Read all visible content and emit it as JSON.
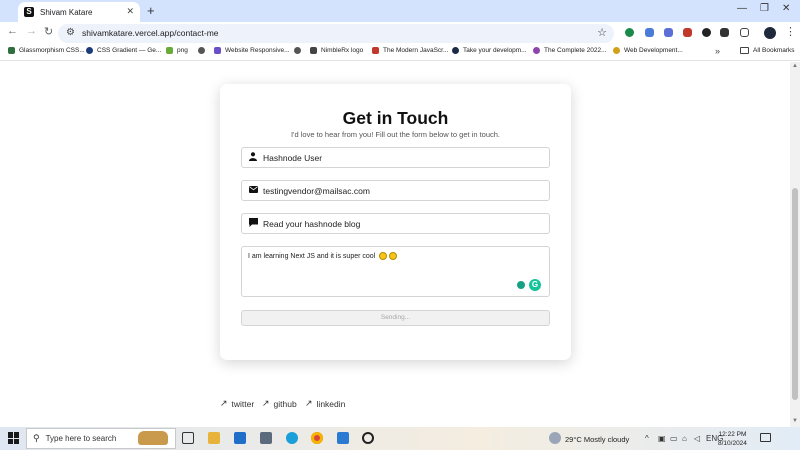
{
  "browser": {
    "tab_title": "Shivam Katare",
    "favicon_letter": "S",
    "url": "shivamkatare.vercel.app/contact-me"
  },
  "bookmarks": [
    {
      "label": "Glassmorphism CSS...",
      "color": "#2f6f3e"
    },
    {
      "label": "CSS Gradient — Ge...",
      "color": "#1d3b78"
    },
    {
      "label": "png",
      "color": "#6aaa3a"
    },
    {
      "label": "",
      "color": "#555555"
    },
    {
      "label": "Website Responsive...",
      "color": "#6a4fc9"
    },
    {
      "label": "",
      "color": "#555555"
    },
    {
      "label": "NimbleRx logo",
      "color": "#444444"
    },
    {
      "label": "The Modern JavaScr...",
      "color": "#c0392b"
    },
    {
      "label": "Take your developm...",
      "color": "#1c2a48"
    },
    {
      "label": "The Complete 2022...",
      "color": "#8e44ad"
    },
    {
      "label": "Web Development...",
      "color": "#d4a017"
    }
  ],
  "all_bookmarks_label": "All Bookmarks",
  "contact": {
    "title": "Get in Touch",
    "subtitle": "I'd love to hear from you! Fill out the form below to get in touch.",
    "name_value": "Hashnode User",
    "email_value": "testingvendor@mailsac.com",
    "subject_value": "Read your hashnode blog",
    "message_value": "I am learning Next JS and it is super cool",
    "submit_label": "Sending..."
  },
  "social_links": [
    "twitter",
    "github",
    "linkedin"
  ],
  "taskbar": {
    "search_placeholder": "Type here to search",
    "weather": "29°C  Mostly cloudy",
    "time": "12:22 PM",
    "date": "8/10/2024"
  },
  "colors": {
    "tabstrip": "#d3e3fd",
    "card_shadow": "rgba(0,0,0,0.17)"
  }
}
